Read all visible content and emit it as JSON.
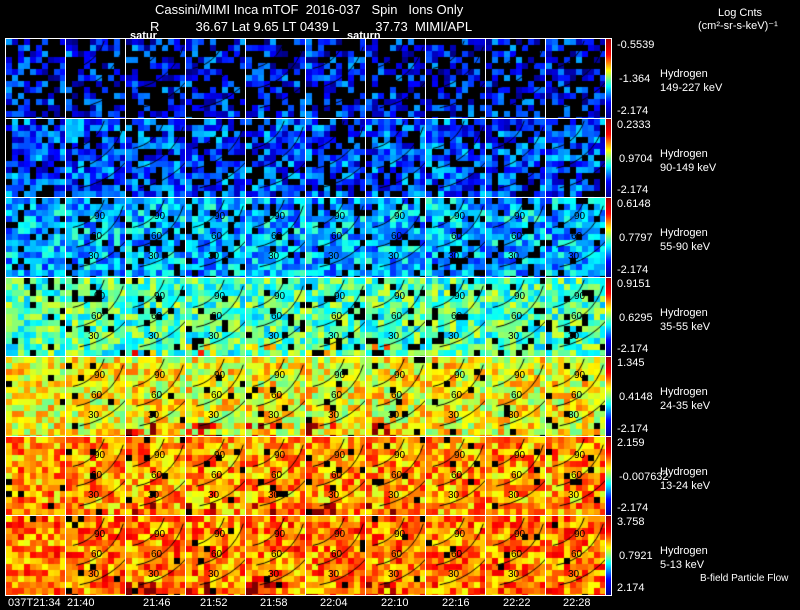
{
  "header": {
    "title": "Cassini/MIMI Inca mTOF  2016-037   Spin   Ions Only",
    "subtitle": "R          36.67 Lat 9.65 LT 0439 L          37.73  MIMI/APL",
    "saturn_labels": [
      "satur",
      "saturn"
    ]
  },
  "units": {
    "line1": "Log Cnts",
    "line2": "(cm²-sr-s-keV)⁻¹"
  },
  "footer_note": "B-field Particle Flow",
  "chart_data": {
    "type": "heatmap",
    "title": "Cassini/MIMI Inca mTOF 2016-037 Spin Ions Only",
    "columns": [
      "037T21:34",
      "21:40",
      "21:46",
      "21:52",
      "21:58",
      "22:04",
      "22:10",
      "22:16",
      "22:22",
      "22:28"
    ],
    "contour_labels": [
      "90",
      "60",
      "30"
    ],
    "rows": [
      {
        "species": "Hydrogen",
        "energy": "149-227 keV",
        "max": "-0.5539",
        "mid": "-1.364",
        "min": "-2.174",
        "level": 0.15,
        "fill": 0.55
      },
      {
        "species": "Hydrogen",
        "energy": "90-149 keV",
        "max": "0.2333",
        "mid": "0.9704",
        "min": "-2.174",
        "level": 0.2,
        "fill": 0.75
      },
      {
        "species": "Hydrogen",
        "energy": "55-90 keV",
        "max": "0.6148",
        "mid": "0.7797",
        "min": "-2.174",
        "level": 0.3,
        "fill": 0.85
      },
      {
        "species": "Hydrogen",
        "energy": "35-55 keV",
        "max": "0.9151",
        "mid": "0.6295",
        "min": "-2.174",
        "level": 0.45,
        "fill": 0.92
      },
      {
        "species": "Hydrogen",
        "energy": "24-35 keV",
        "max": "1.345",
        "mid": "0.4148",
        "min": "-2.174",
        "level": 0.62,
        "fill": 0.95
      },
      {
        "species": "Hydrogen",
        "energy": "13-24 keV",
        "max": "2.159",
        "mid": "-0.007632",
        "min": "-2.174",
        "level": 0.72,
        "fill": 0.96
      },
      {
        "species": "Hydrogen",
        "energy": "5-13 keV",
        "max": "3.758",
        "mid": "0.7921",
        "min": "2.174",
        "level": 0.75,
        "fill": 0.97
      }
    ]
  }
}
